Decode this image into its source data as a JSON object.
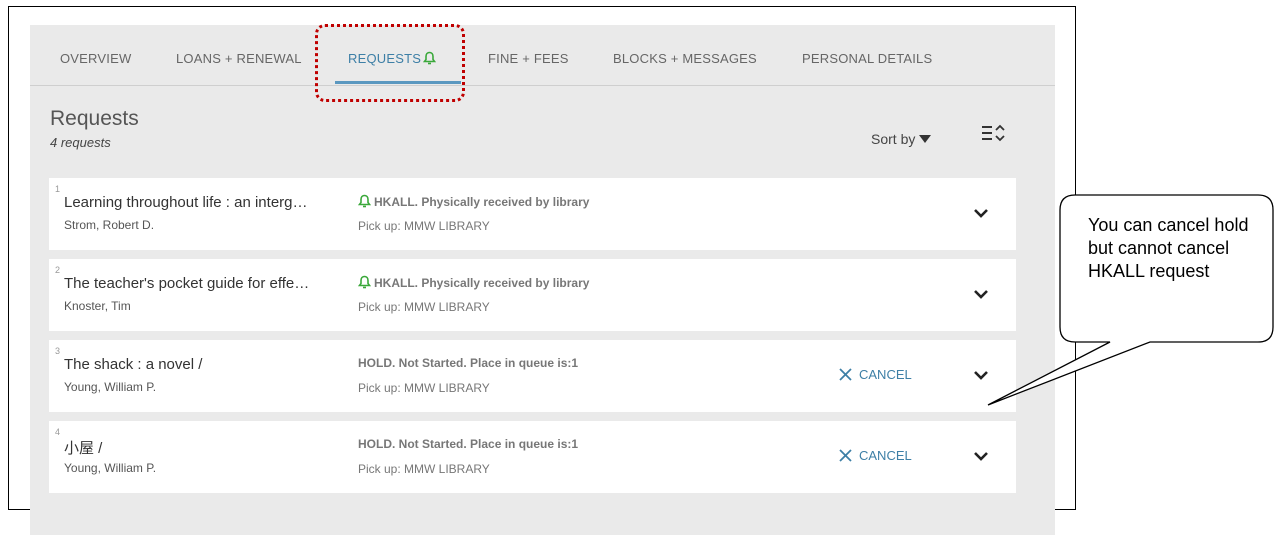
{
  "tabs": [
    {
      "label": "OVERVIEW"
    },
    {
      "label": "LOANS + RENEWAL"
    },
    {
      "label": "REQUESTS"
    },
    {
      "label": "FINE + FEES"
    },
    {
      "label": "BLOCKS + MESSAGES"
    },
    {
      "label": "PERSONAL DETAILS"
    }
  ],
  "active_tab": "REQUESTS",
  "header": {
    "title": "Requests",
    "count": "4 requests"
  },
  "sort": {
    "label": "Sort by"
  },
  "requests": [
    {
      "index": "1",
      "title": "Learning throughout life : an interg…",
      "author": "Strom, Robert D.",
      "status": "HKALL. Physically received by library",
      "status_icon": "bell-icon",
      "pickup": "Pick up: MMW LIBRARY",
      "cancel": ""
    },
    {
      "index": "2",
      "title": "The teacher's pocket guide for effe…",
      "author": "Knoster, Tim",
      "status": "HKALL. Physically received by library",
      "status_icon": "bell-icon",
      "pickup": "Pick up: MMW LIBRARY",
      "cancel": ""
    },
    {
      "index": "3",
      "title": "The shack : a novel /",
      "author": "Young, William P.",
      "status": "HOLD. Not Started. Place in queue is:1",
      "status_icon": "",
      "pickup": "Pick up: MMW LIBRARY",
      "cancel": "CANCEL"
    },
    {
      "index": "4",
      "title": "小屋 /",
      "author": "Young, William P.",
      "status": "HOLD. Not Started. Place in queue is:1",
      "status_icon": "",
      "pickup": "Pick up: MMW LIBRARY",
      "cancel": "CANCEL"
    }
  ],
  "callout": {
    "text": "You can cancel hold but cannot cancel HKALL request"
  },
  "colors": {
    "accent": "#3d7fa6",
    "bell": "#3aa83a",
    "highlight": "#c00000",
    "panel": "#eaeaea"
  }
}
